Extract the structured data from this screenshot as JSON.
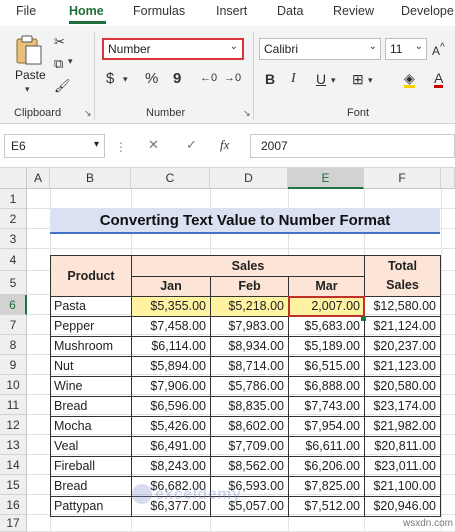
{
  "menu": {
    "tabs": [
      "File",
      "Home",
      "Formulas",
      "Insert",
      "Data",
      "Review",
      "Develope"
    ],
    "active_tab": "Home"
  },
  "ribbon": {
    "clipboard": {
      "paste_label": "Paste",
      "group_label": "Clipboard"
    },
    "number": {
      "format_value": "Number",
      "currency_symbol": "$",
      "percent_symbol": "%",
      "comma_symbol": "9",
      "group_label": "Number"
    },
    "font": {
      "font_name": "Calibri",
      "font_size": "11",
      "bold": "B",
      "italic": "I",
      "underline": "U",
      "group_label": "Font"
    }
  },
  "formula_bar": {
    "name_box": "E6",
    "fx_label": "fx",
    "value": "2007"
  },
  "columns": [
    "A",
    "B",
    "C",
    "D",
    "E",
    "F"
  ],
  "rows": [
    "1",
    "2",
    "3",
    "4",
    "5",
    "6",
    "7",
    "8",
    "9",
    "10",
    "11",
    "12",
    "13",
    "14",
    "15",
    "16",
    "17"
  ],
  "sheet": {
    "title": "Converting Text Value to Number Format",
    "header_product": "Product",
    "header_sales": "Sales",
    "header_total": "Total Sales",
    "months": [
      "Jan",
      "Feb",
      "Mar"
    ],
    "data": [
      {
        "product": "Pasta",
        "jan": "$5,355.00",
        "feb": "$5,218.00",
        "mar": "2,007.00",
        "total": "$12,580.00"
      },
      {
        "product": "Pepper",
        "jan": "$7,458.00",
        "feb": "$7,983.00",
        "mar": "$5,683.00",
        "total": "$21,124.00"
      },
      {
        "product": "Mushroom",
        "jan": "$6,114.00",
        "feb": "$8,934.00",
        "mar": "$5,189.00",
        "total": "$20,237.00"
      },
      {
        "product": "Nut",
        "jan": "$5,894.00",
        "feb": "$8,714.00",
        "mar": "$6,515.00",
        "total": "$21,123.00"
      },
      {
        "product": "Wine",
        "jan": "$7,906.00",
        "feb": "$5,786.00",
        "mar": "$6,888.00",
        "total": "$20,580.00"
      },
      {
        "product": "Bread",
        "jan": "$6,596.00",
        "feb": "$8,835.00",
        "mar": "$7,743.00",
        "total": "$23,174.00"
      },
      {
        "product": "Mocha",
        "jan": "$5,426.00",
        "feb": "$8,602.00",
        "mar": "$7,954.00",
        "total": "$21,982.00"
      },
      {
        "product": "Veal",
        "jan": "$6,491.00",
        "feb": "$7,709.00",
        "mar": "$6,611.00",
        "total": "$20,811.00"
      },
      {
        "product": "Fireball",
        "jan": "$8,243.00",
        "feb": "$8,562.00",
        "mar": "$6,206.00",
        "total": "$23,011.00"
      },
      {
        "product": "Bread",
        "jan": "$6,682.00",
        "feb": "$6,593.00",
        "mar": "$7,825.00",
        "total": "$21,100.00"
      },
      {
        "product": "Pattypan",
        "jan": "$6,377.00",
        "feb": "$5,057.00",
        "mar": "$7,512.00",
        "total": "$20,946.00"
      }
    ]
  },
  "watermark": {
    "brand": "exceldemy",
    "site": "wsxdn.com"
  },
  "colors": {
    "accent": "#217346",
    "highlight": "#fff2a0",
    "header_fill": "#fce4d6",
    "title_fill": "#d9e1f2",
    "active_border": "#c0312b"
  }
}
